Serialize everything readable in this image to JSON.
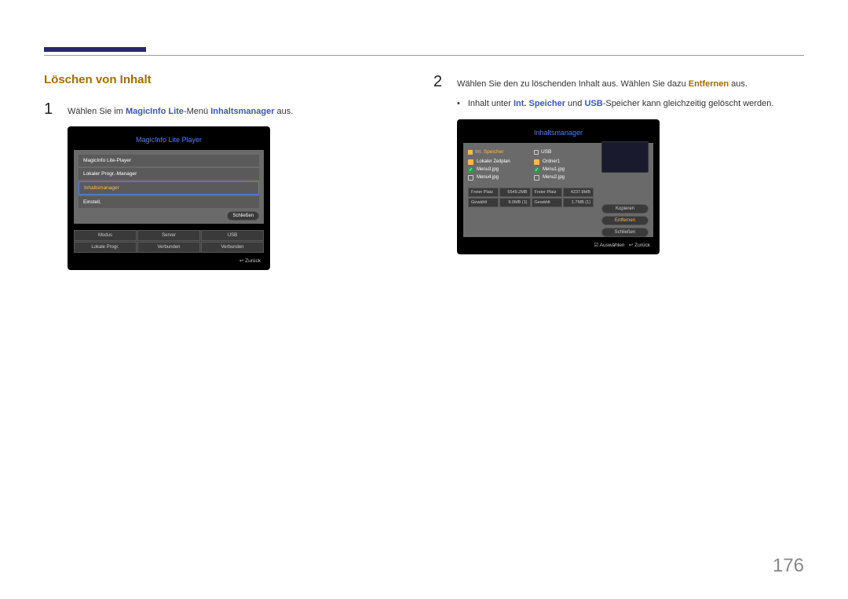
{
  "section_title": "Löschen von Inhalt",
  "step1": {
    "num": "1",
    "pre": "Wählen Sie im ",
    "hl1": "MagicInfo Lite",
    "mid": "-Menü ",
    "hl2": "Inhaltsmanager",
    "post": " aus."
  },
  "step2": {
    "num": "2",
    "pre": "Wählen Sie den zu löschenden Inhalt aus. Wählen Sie dazu ",
    "hl": "Entfernen",
    "post": " aus."
  },
  "bullet": {
    "pre": "Inhalt unter ",
    "hl1": "Int. Speicher",
    "mid": " und ",
    "hl2": "USB",
    "post": "-Speicher kann gleichzeitig gelöscht werden."
  },
  "panel1": {
    "title": "MagicInfo Lite Player",
    "items": [
      "MagicInfo Lite-Player",
      "Lokaler Progr.-Manager",
      "Inhaltsmanager",
      "Einstell."
    ],
    "close": "Schließen",
    "grid": {
      "h1": "Modus",
      "h2": "Server",
      "h3": "USB",
      "v1": "Lokale Progr.",
      "v2": "Verbunden",
      "v3": "Verbunden"
    },
    "back": "Zurück"
  },
  "panel2": {
    "title": "Inhaltsmanager",
    "col1": {
      "head": "Int. Speicher",
      "rows": [
        {
          "chk": "off",
          "label": "Lokaler Zeitplan"
        },
        {
          "chk": "on",
          "label": "Menu3.jpg"
        },
        {
          "chk": "plain",
          "label": "Menu4.jpg"
        }
      ]
    },
    "col2": {
      "head": "USB",
      "rows": [
        {
          "chk": "off",
          "label": "Ordner1"
        },
        {
          "chk": "on",
          "label": "Menu1.jpg"
        },
        {
          "chk": "plain",
          "label": "Menu2.jpg"
        }
      ]
    },
    "btns": {
      "copy": "Kopieren",
      "remove": "Entfernen",
      "close": "Schließen"
    },
    "info": {
      "l1": "Freier Platz",
      "v1": "5549.2MB",
      "l2": "Freier Platz",
      "v2": "4237.8MB",
      "l3": "Gewählt",
      "v3": "9.0MB (1)",
      "l4": "Gewählt",
      "v4": "1.7MB (1)"
    },
    "sel": "Auswählen",
    "back": "Zurück"
  },
  "page_number": "176"
}
